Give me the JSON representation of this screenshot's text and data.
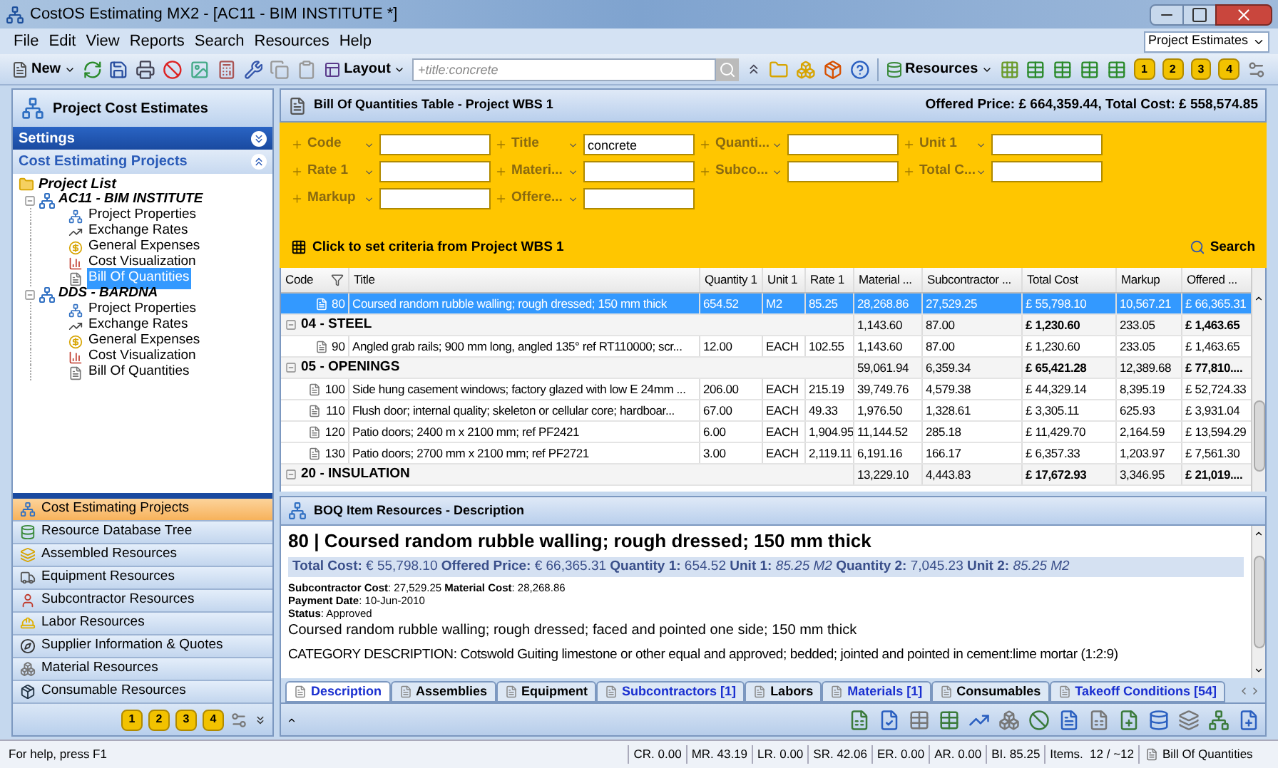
{
  "window": {
    "title": "CostOS Estimating MX2 - [AC11 - BIM INSTITUTE *]"
  },
  "menu": [
    "File",
    "Edit",
    "View",
    "Reports",
    "Search",
    "Resources",
    "Help"
  ],
  "project_selector": {
    "value": "Project Estimates"
  },
  "toolbar": {
    "new_label": "New",
    "layout_label": "Layout",
    "search": {
      "placeholder": "+title:concrete"
    },
    "resources_label": "Resources",
    "level_buttons": [
      "1",
      "2",
      "3",
      "4"
    ]
  },
  "sidebar": {
    "title": "Project Cost Estimates",
    "sections": [
      {
        "label": "Settings",
        "expanded": false
      },
      {
        "label": "Cost Estimating Projects",
        "expanded": true
      }
    ],
    "tree": {
      "label": "Project List",
      "children": [
        {
          "label": "AC11 - BIM INSTITUTE",
          "expanded": true,
          "children": [
            {
              "label": "Project Properties",
              "kind": "properties",
              "selected": false
            },
            {
              "label": "Exchange Rates",
              "kind": "rates",
              "selected": false
            },
            {
              "label": "General Expenses",
              "kind": "expenses",
              "selected": false
            },
            {
              "label": "Cost Visualization",
              "kind": "visualization",
              "selected": false
            },
            {
              "label": "Bill Of Quantities",
              "kind": "boq",
              "selected": true
            }
          ]
        },
        {
          "label": "DDS - BARDNA",
          "expanded": true,
          "children": [
            {
              "label": "Project Properties",
              "kind": "properties",
              "selected": false
            },
            {
              "label": "Exchange Rates",
              "kind": "rates",
              "selected": false
            },
            {
              "label": "General Expenses",
              "kind": "expenses",
              "selected": false
            },
            {
              "label": "Cost Visualization",
              "kind": "visualization",
              "selected": false
            },
            {
              "label": "Bill Of Quantities",
              "kind": "boq",
              "selected": false
            }
          ]
        }
      ]
    },
    "nav": [
      {
        "label": "Cost Estimating Projects",
        "kind": "projects",
        "selected": true
      },
      {
        "label": "Resource Database Tree",
        "kind": "database",
        "selected": false
      },
      {
        "label": "Assembled Resources",
        "kind": "assembled",
        "selected": false
      },
      {
        "label": "Equipment Resources",
        "kind": "equipment",
        "selected": false
      },
      {
        "label": "Subcontractor Resources",
        "kind": "subcontractor",
        "selected": false
      },
      {
        "label": "Labor Resources",
        "kind": "labor",
        "selected": false
      },
      {
        "label": "Supplier Information & Quotes",
        "kind": "supplier",
        "selected": false
      },
      {
        "label": "Material Resources",
        "kind": "material",
        "selected": false
      },
      {
        "label": "Consumable Resources",
        "kind": "consumable",
        "selected": false
      }
    ],
    "footer_level_buttons": [
      "1",
      "2",
      "3",
      "4"
    ]
  },
  "boq": {
    "title": "Bill Of Quantities Table - Project WBS 1",
    "totals": "Offered Price: £ 664,359.44, Total Cost: £ 558,574.85",
    "filters": [
      {
        "label": "Code"
      },
      {
        "label": "Title",
        "value": "concrete"
      },
      {
        "label": "Quanti..."
      },
      {
        "label": "Unit 1"
      },
      {
        "label": "Rate 1"
      },
      {
        "label": "Materi..."
      },
      {
        "label": "Subco..."
      },
      {
        "label": "Total C..."
      },
      {
        "label": "Markup"
      },
      {
        "label": "Offere..."
      }
    ],
    "criteria_link": "Click to set criteria from Project WBS 1",
    "search_button": "Search",
    "table": {
      "columns": [
        "Code",
        "Title",
        "Quantity 1",
        "Unit 1",
        "Rate 1",
        "Material ...",
        "Subcontractor ...",
        "Total Cost",
        "Markup",
        "Offered ..."
      ],
      "rows": [
        {
          "kind": "item",
          "selected": true,
          "code": "80",
          "title": "Coursed random rubble walling; rough dressed; 150 mm thick",
          "quantity_1": "654.52",
          "unit_1": "M2",
          "rate_1": "85.25",
          "material": "28,268.86",
          "subcontractor": "27,529.25",
          "total_cost": "£ 55,798.10",
          "markup": "10,567.21",
          "offered": "£ 66,365.31"
        },
        {
          "kind": "group",
          "selected": false,
          "expanded": true,
          "title": "04 - STEEL",
          "material": "1,143.60",
          "subcontractor": "87.00",
          "total_cost": "£ 1,230.60",
          "markup": "233.05",
          "offered": "£ 1,463.65"
        },
        {
          "kind": "item",
          "selected": false,
          "code": "90",
          "title": "Angled grab rails; 900 mm long, angled 135° ref RT110000; scr...",
          "quantity_1": "12.00",
          "unit_1": "EACH",
          "rate_1": "102.55",
          "material": "1,143.60",
          "subcontractor": "87.00",
          "total_cost": "£ 1,230.60",
          "markup": "233.05",
          "offered": "£ 1,463.65"
        },
        {
          "kind": "group",
          "selected": false,
          "expanded": true,
          "title": "05 - OPENINGS",
          "material": "59,061.94",
          "subcontractor": "6,359.34",
          "total_cost": "£ 65,421.28",
          "markup": "12,389.68",
          "offered": "£ 77,810...."
        },
        {
          "kind": "item",
          "selected": false,
          "code": "100",
          "title": "Side hung casement windows; factory glazed with low E 24mm ...",
          "quantity_1": "206.00",
          "unit_1": "EACH",
          "rate_1": "215.19",
          "material": "39,749.76",
          "subcontractor": "4,579.38",
          "total_cost": "£ 44,329.14",
          "markup": "8,395.19",
          "offered": "£ 52,724.33"
        },
        {
          "kind": "item",
          "selected": false,
          "code": "110",
          "title": "Flush door; internal quality; skeleton or cellular core; hardboar...",
          "quantity_1": "67.00",
          "unit_1": "EACH",
          "rate_1": "49.33",
          "material": "1,976.50",
          "subcontractor": "1,328.61",
          "total_cost": "£ 3,305.11",
          "markup": "625.93",
          "offered": "£ 3,931.04"
        },
        {
          "kind": "item",
          "selected": false,
          "code": "120",
          "title": "Patio doors; 2400 m x 2100 mm; ref PF2421",
          "quantity_1": "6.00",
          "unit_1": "EACH",
          "rate_1": "1,904.95",
          "material": "11,144.52",
          "subcontractor": "285.18",
          "total_cost": "£ 11,429.70",
          "markup": "2,164.59",
          "offered": "£ 13,594.29"
        },
        {
          "kind": "item",
          "selected": false,
          "code": "130",
          "title": "Patio doors; 2700 mm x 2100 mm; ref PF2721",
          "quantity_1": "3.00",
          "unit_1": "EACH",
          "rate_1": "2,119.11",
          "material": "6,191.16",
          "subcontractor": "166.17",
          "total_cost": "£ 6,357.33",
          "markup": "1,203.97",
          "offered": "£ 7,561.30"
        },
        {
          "kind": "group",
          "selected": false,
          "expanded": true,
          "title": "20 - INSULATION",
          "material": "13,229.10",
          "subcontractor": "4,443.83",
          "total_cost": "£ 17,672.93",
          "markup": "3,346.95",
          "offered": "£ 21,019...."
        }
      ]
    }
  },
  "details": {
    "title": "BOQ Item Resources - Description",
    "heading": "80 | Coursed random rubble walling; rough dressed; 150 mm thick",
    "summary": "**Total Cost:** € 55,798.10 **Offered Price:** € 66,365.31 **Quantity 1:** 654.52 **Unit 1:** *85.25 M2* **Quantity 2:** 7,045.23 **Unit 2:** *85.25 M2*",
    "fields": [
      "**Subcontractor Cost**: 27,529.25 **Material Cost**: 28,268.86",
      "**Payment Date**: 10-Jun-2010",
      "**Status**: Approved"
    ],
    "description": "Coursed random rubble walling; rough dressed; faced and pointed one side; 150 mm thick",
    "category": "CATEGORY DESCRIPTION: Cotswold Guiting limestone or other equal and approved; bedded; jointed and pointed in cement:lime mortar (1:2:9)",
    "tabs": [
      {
        "label": "Description",
        "selected": true,
        "highlighted": true
      },
      {
        "label": "Assemblies",
        "selected": false,
        "highlighted": false
      },
      {
        "label": "Equipment",
        "selected": false,
        "highlighted": false
      },
      {
        "label": "Subcontractors [1]",
        "selected": false,
        "highlighted": true
      },
      {
        "label": "Labors",
        "selected": false,
        "highlighted": false
      },
      {
        "label": "Materials [1]",
        "selected": false,
        "highlighted": true
      },
      {
        "label": "Consumables",
        "selected": false,
        "highlighted": false
      },
      {
        "label": "Takeoff Conditions [54]",
        "selected": false,
        "highlighted": true
      }
    ]
  },
  "status_bar": {
    "help": "For help, press F1",
    "cells": [
      "CR. 0.00",
      "MR. 43.19",
      "LR. 0.00",
      "SR. 42.06",
      "ER. 0.00",
      "AR. 0.00",
      "BI. 85.25",
      "Items.  12 / ~12"
    ],
    "view": "Bill Of Quantities"
  }
}
